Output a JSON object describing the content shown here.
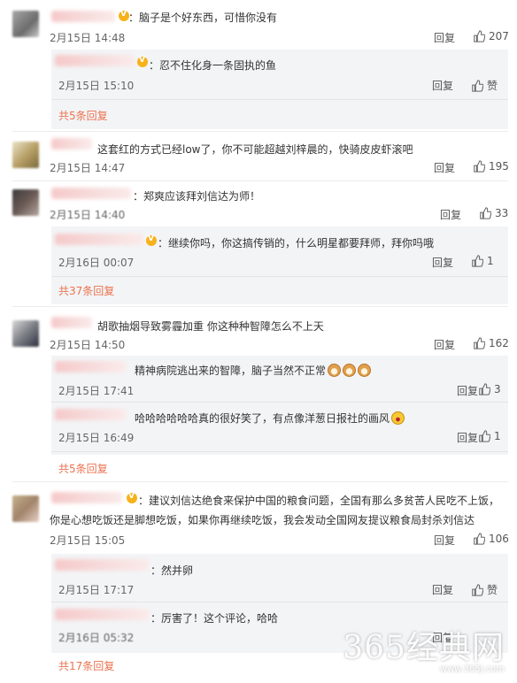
{
  "ui": {
    "reply_label": "回复",
    "like_word": "赞",
    "colors": {
      "accent_link": "#eb7350",
      "sub_bg": "#f3f4f6"
    }
  },
  "comments": [
    {
      "text": "：脑子是个好东西，可惜你没有",
      "date": "2月15日 14:48",
      "likes": "207",
      "subs": [
        {
          "text": "：忍不住化身一条固执的鱼",
          "date": "2月15日 15:10",
          "likes": "赞"
        }
      ],
      "more": "共5条回复"
    },
    {
      "text": "这套红的方式已经low了，你不可能超越刘梓晨的，快骑皮皮虾滚吧",
      "date": "2月15日 14:47",
      "likes": "195",
      "subs": [],
      "more": ""
    },
    {
      "text": "：郑爽应该拜刘信达为师！",
      "date": "2月15日 14:40",
      "likes": "33",
      "subs": [
        {
          "text": "：继续你吗，你这搞传销的，什么明星都要拜师，拜你吗哦",
          "date": "2月16日 00:07",
          "likes": "1"
        }
      ],
      "more": "共37条回复"
    },
    {
      "text": "胡歌抽烟导致雾霾加重 你这种种智障怎么不上天",
      "date": "2月15日 14:50",
      "likes": "162",
      "subs": [
        {
          "text": "精神病院逃出来的智障，脑子当然不正常",
          "date": "2月15日 17:41",
          "likes": "3"
        },
        {
          "text": "哈哈哈哈哈哈真的很好笑了，有点像洋葱日报社的画风",
          "date": "2月15日 16:49",
          "likes": "1"
        }
      ],
      "more": "共5条回复"
    },
    {
      "text": "：建议刘信达绝食来保护中国的粮食问题，全国有那么多贫苦人民吃不上饭，",
      "text2": "你是心想吃饭还是脚想吃饭，如果你再继续吃饭，我会发动全国网友提议粮食局封杀刘信达",
      "date": "2月15日 15:05",
      "likes": "106",
      "subs": [
        {
          "text": "：然并卵",
          "date": "2月15日 17:17",
          "likes": "赞"
        },
        {
          "text": "：厉害了！这个评论，哈哈",
          "date": "2月16日 05:32",
          "likes": "赞"
        }
      ],
      "more": "共17条回复"
    }
  ],
  "watermark": {
    "big": "365经典网",
    "small": "www.365j.com"
  }
}
